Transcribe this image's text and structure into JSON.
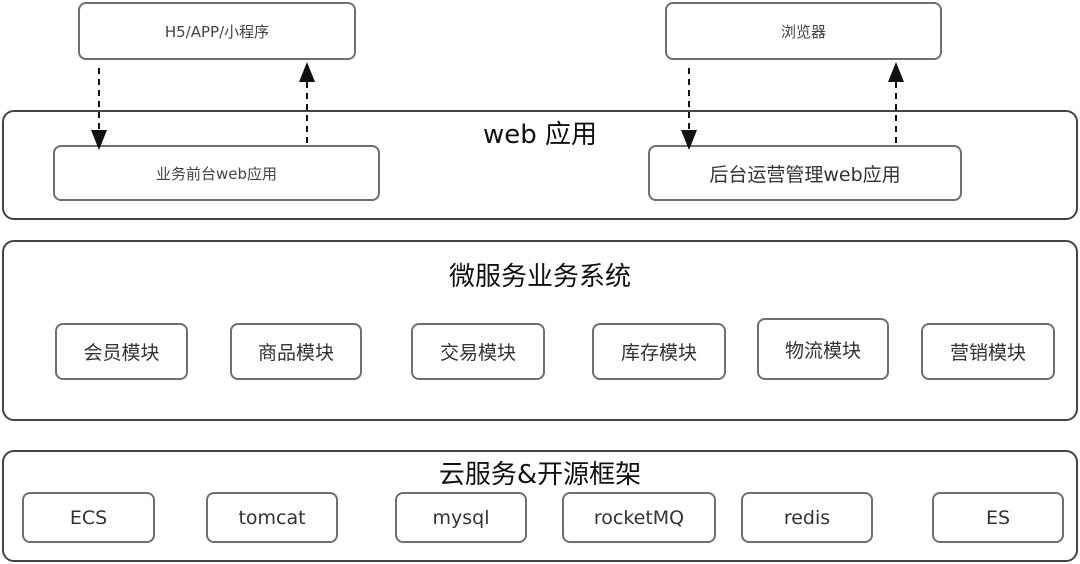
{
  "clients": {
    "mobile": "H5/APP/小程序",
    "browser": "浏览器"
  },
  "web_layer": {
    "title": "web 应用",
    "frontend": "业务前台web应用",
    "backend": "后台运营管理web应用"
  },
  "micro_layer": {
    "title": "微服务业务系统",
    "modules": [
      "会员模块",
      "商品模块",
      "交易模块",
      "库存模块",
      "物流模块",
      "营销模块"
    ]
  },
  "cloud_layer": {
    "title": "云服务&开源框架",
    "items": [
      "ECS",
      "tomcat",
      "mysql",
      "rocketMQ",
      "redis",
      "ES"
    ]
  }
}
